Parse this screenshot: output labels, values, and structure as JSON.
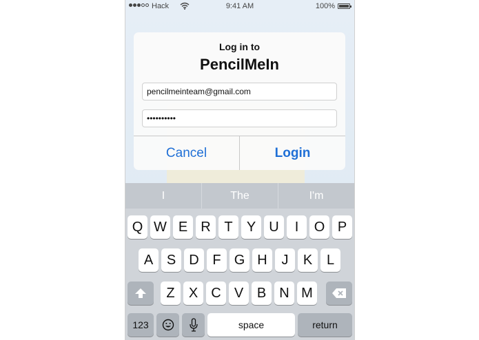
{
  "status_bar": {
    "carrier": "Hack",
    "time": "9:41 AM",
    "battery": "100%",
    "signal_bars_filled": 3,
    "signal_bars_total": 5
  },
  "dialog": {
    "title": "Log in to",
    "app_name": "PencilMeIn",
    "email_value": "pencilmeinteam@gmail.com",
    "password_value": "••••••••••",
    "cancel_label": "Cancel",
    "login_label": "Login"
  },
  "suggestions": [
    "I",
    "The",
    "I'm"
  ],
  "keyboard": {
    "row1": [
      "Q",
      "W",
      "E",
      "R",
      "T",
      "Y",
      "U",
      "I",
      "O",
      "P"
    ],
    "row2": [
      "A",
      "S",
      "D",
      "F",
      "G",
      "H",
      "J",
      "K",
      "L"
    ],
    "row3": [
      "Z",
      "X",
      "C",
      "V",
      "B",
      "N",
      "M"
    ],
    "numbers_label": "123",
    "space_label": "space",
    "return_label": "return",
    "icons": {
      "shift": "shift-icon",
      "delete": "backspace-icon",
      "emoji": "emoji-icon",
      "mic": "microphone-icon"
    }
  },
  "colors": {
    "accent": "#1f6fd6",
    "keyboard_bg": "#d0d4d9",
    "suggestion_bar": "#c3c8ce"
  }
}
